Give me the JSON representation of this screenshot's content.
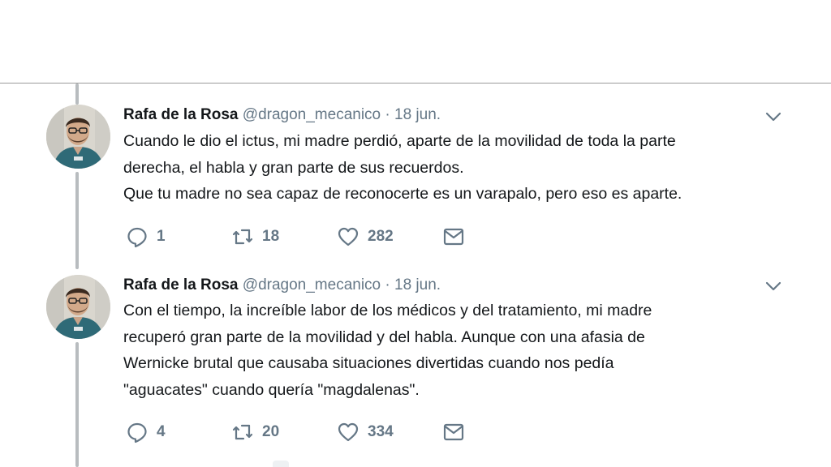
{
  "tweets": [
    {
      "name": "Rafa de la Rosa",
      "handle": "@dragon_mecanico",
      "separator": "·",
      "date": "18 jun.",
      "text": "Cuando le dio el ictus, mi madre perdió, aparte de la movilidad de toda la parte\nderecha, el habla y gran parte de sus recuerdos.\nQue tu madre no sea capaz de reconocerte es un varapalo, pero eso es aparte.",
      "replies": "1",
      "retweets": "18",
      "likes": "282"
    },
    {
      "name": "Rafa de la Rosa",
      "handle": "@dragon_mecanico",
      "separator": "·",
      "date": "18 jun.",
      "text": "Con el tiempo, la increíble labor de los médicos y del tratamiento, mi madre\nrecuperó gran parte de la movilidad y del habla. Aunque con una afasia de\nWernicke brutal que causaba situaciones divertidas cuando nos pedía\n\"aguacates\" cuando quería \"magdalenas\".",
      "replies": "4",
      "retweets": "20",
      "likes": "334"
    }
  ],
  "icons": {
    "reply": "reply-icon",
    "retweet": "retweet-icon",
    "like": "heart-icon",
    "message": "envelope-icon",
    "more": "chevron-down-icon"
  },
  "colors": {
    "text": "#14171a",
    "secondary": "#657786",
    "thread_line": "#b8bcbf",
    "divider": "#9b9b9b"
  }
}
